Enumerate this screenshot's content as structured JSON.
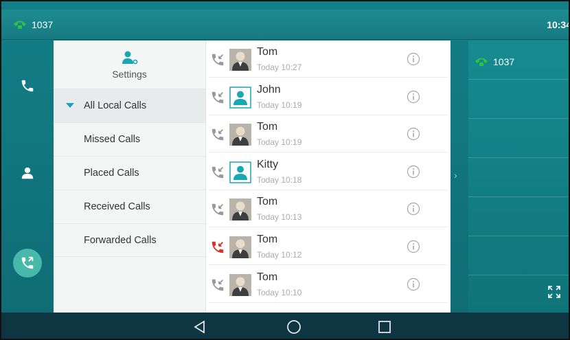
{
  "status_bar": {
    "account": "1037",
    "time": "10:34",
    "phone_icon": "handset-icon"
  },
  "left_rail": {
    "items": [
      {
        "name": "dialer",
        "icon": "handset-icon"
      },
      {
        "name": "directory",
        "icon": "contact-icon"
      },
      {
        "name": "call-log",
        "icon": "call-log-icon"
      }
    ]
  },
  "menu": {
    "settings_label": "Settings",
    "items": [
      {
        "label": "All Local Calls",
        "active": true
      },
      {
        "label": "Missed Calls"
      },
      {
        "label": "Placed Calls"
      },
      {
        "label": "Received Calls"
      },
      {
        "label": "Forwarded Calls"
      }
    ]
  },
  "calls": [
    {
      "name": "Tom",
      "time": "Today 10:27",
      "type": "received",
      "avatar": "photo"
    },
    {
      "name": "John",
      "time": "Today 10:19",
      "type": "received",
      "avatar": "contact"
    },
    {
      "name": "Tom",
      "time": "Today 10:19",
      "type": "received",
      "avatar": "photo"
    },
    {
      "name": "Kitty",
      "time": "Today 10:18",
      "type": "received",
      "avatar": "contact"
    },
    {
      "name": "Tom",
      "time": "Today 10:13",
      "type": "received",
      "avatar": "photo"
    },
    {
      "name": "Tom",
      "time": "Today 10:12",
      "type": "missed",
      "avatar": "photo"
    },
    {
      "name": "Tom",
      "time": "Today 10:10",
      "type": "received",
      "avatar": "photo"
    }
  ],
  "right_panel": {
    "account": "1037"
  },
  "colors": {
    "teal": "#137f86",
    "accent": "#18a3b8",
    "missed": "#d9342b",
    "green": "#2ec246"
  },
  "nav": {
    "back": "back-icon",
    "home": "home-icon",
    "recents": "recents-icon"
  }
}
